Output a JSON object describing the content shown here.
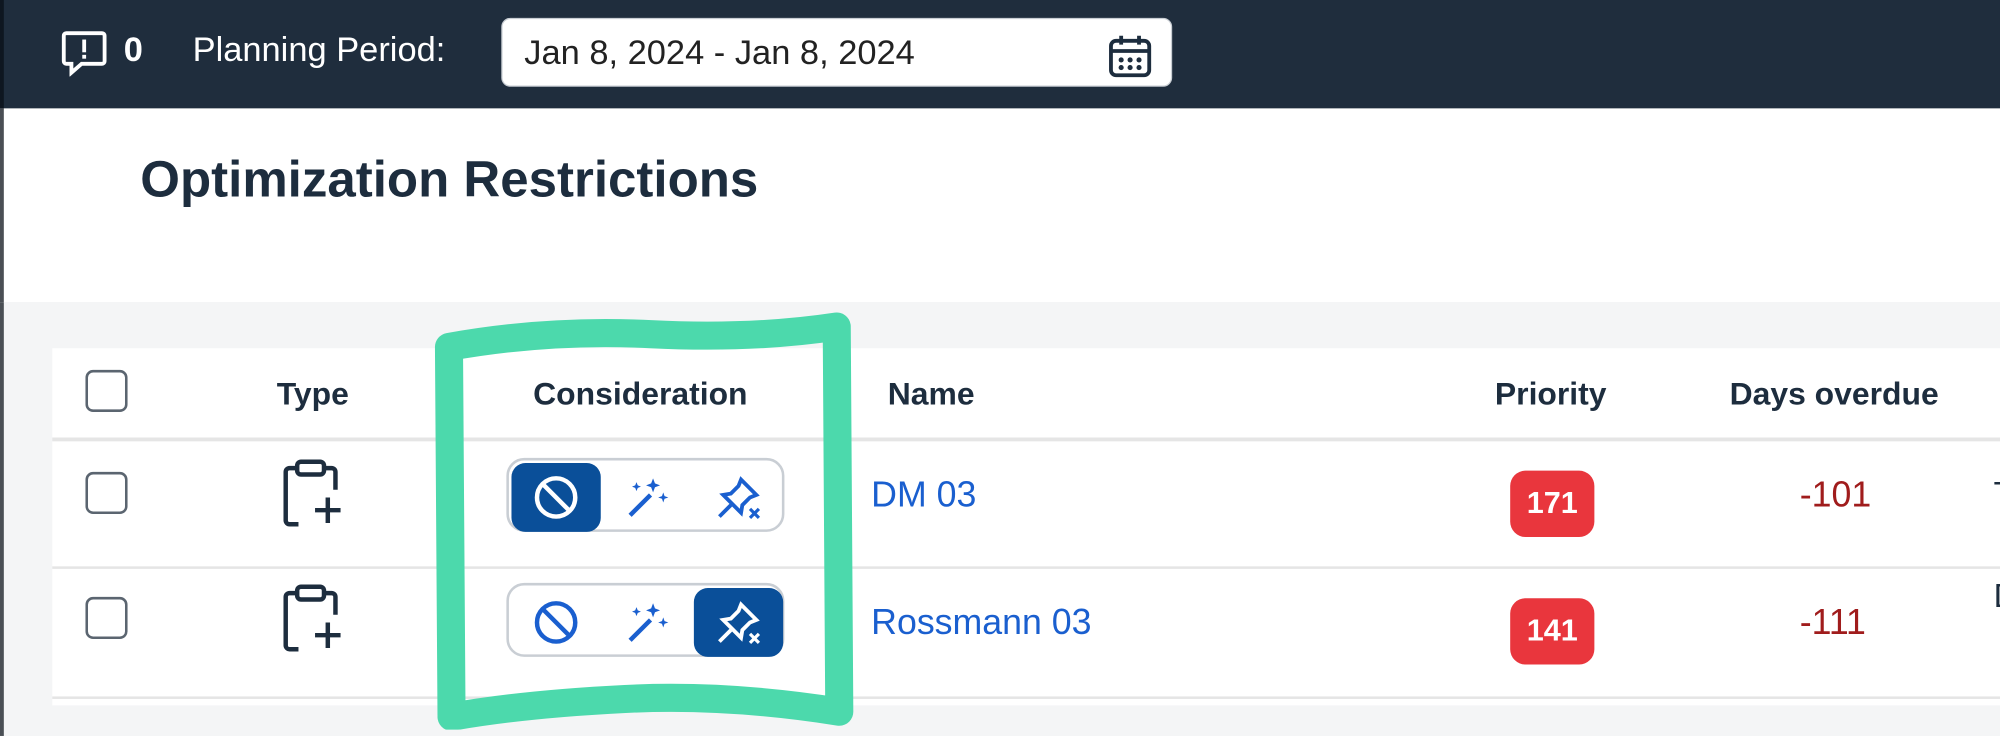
{
  "header": {
    "message_count": "0",
    "planning_period_label": "Planning Period:",
    "planning_period_value": "Jan 8, 2024 - Jan 8, 2024"
  },
  "page": {
    "title": "Optimization Restrictions"
  },
  "table": {
    "columns": [
      "Type",
      "Consideration",
      "Name",
      "Priority",
      "Days overdue"
    ],
    "rows": [
      {
        "name": "DM 03",
        "priority": "171",
        "days_overdue": "-101",
        "consideration_selected": "exclude",
        "edge_text": "T"
      },
      {
        "name": "Rossmann 03",
        "priority": "141",
        "days_overdue": "-111",
        "consideration_selected": "unpin",
        "edge_text": "D"
      }
    ]
  },
  "icons": {
    "messages": "message-alert-icon",
    "calendar": "calendar-icon",
    "type": "clipboard-add-icon",
    "exclude": "block-icon",
    "optimize": "magic-wand-icon",
    "unpin": "unpin-icon"
  },
  "colors": {
    "topbar": "#1f2d3d",
    "accent": "#0a4f99",
    "link": "#1a5fcf",
    "priority_badge": "#e9363d",
    "overdue_text": "#a01c1c",
    "highlight": "#4cd9ac"
  }
}
